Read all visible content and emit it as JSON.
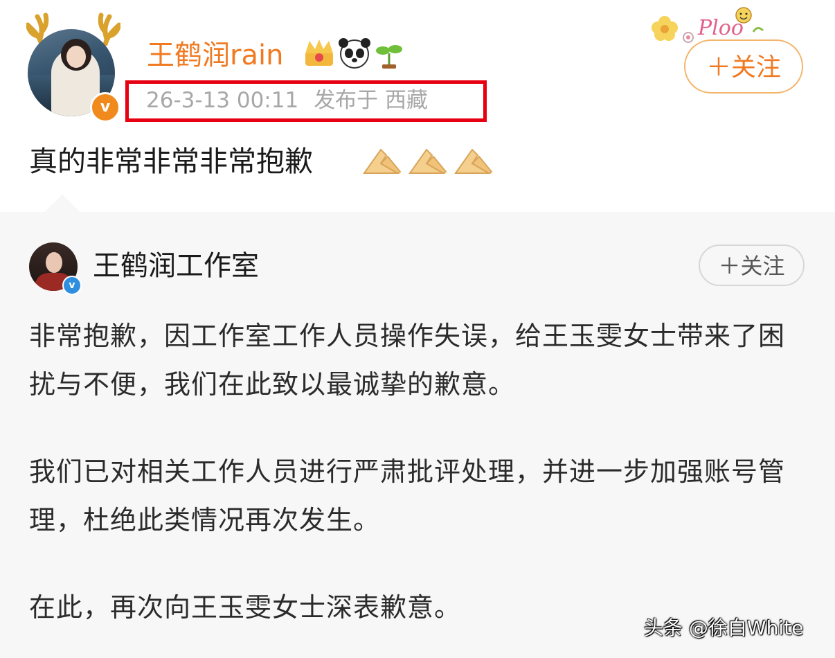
{
  "post": {
    "username": "王鹤润rain",
    "user_badges": [
      "crown-icon",
      "panda-icon",
      "sprout-icon"
    ],
    "timestamp": "26-3-13 00:11",
    "location": "发布于 西藏",
    "follow_label": "＋关注",
    "text": "真的非常非常非常抱歉",
    "text_emojis": [
      "praying-hands-icon",
      "praying-hands-icon",
      "praying-hands-icon"
    ],
    "sticker_text": "Ploo"
  },
  "repost": {
    "author": "王鹤润工作室",
    "follow_label": "＋关注",
    "paragraphs": [
      "非常抱歉，因工作室工作人员操作失误，给王玉雯女士带来了困扰与不便，我们在此致以最诚挚的歉意。",
      "我们已对相关工作人员进行严肃批评处理，并进一步加强账号管理，杜绝此类情况再次发生。",
      "在此，再次向王玉雯女士深表歉意。"
    ]
  },
  "watermark": "头条 @徐白White",
  "colors": {
    "username": "#f07a22",
    "highlight_box": "#e60012",
    "meta_text": "#a7a7a7",
    "verified_orange": "#f08a1c",
    "verified_blue": "#2f8fde",
    "repost_bg": "#f7f7f7"
  }
}
